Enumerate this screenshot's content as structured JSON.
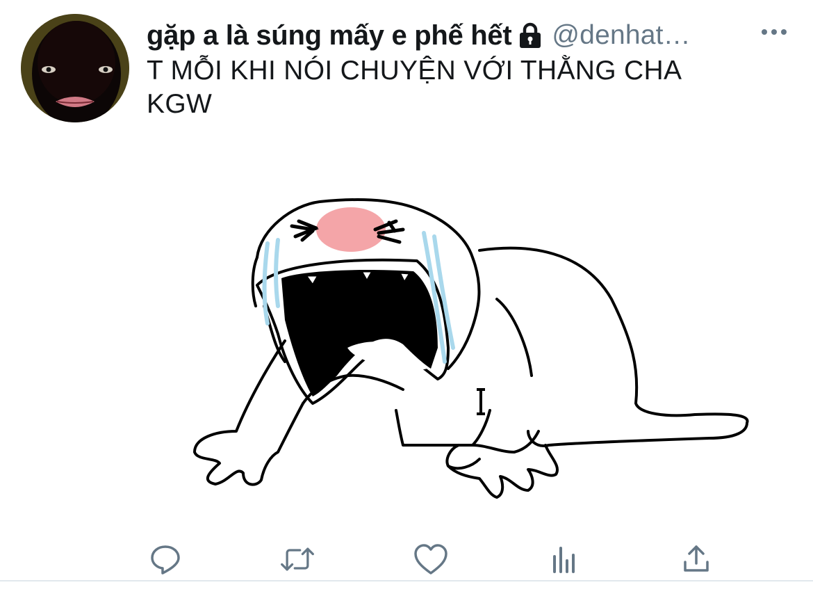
{
  "tweet": {
    "display_name": "gặp a là súng mấy e phế hết",
    "handle": "@denhat…",
    "text_line1": "T MỖI KHI NÓI CHUYỆN VỚI THẰNG CHA",
    "text_line2": "KGW",
    "protected_icon": "lock-icon",
    "more_icon": "more-dots-icon"
  },
  "actions": {
    "reply_icon": "reply-icon",
    "retweet_icon": "retweet-icon",
    "like_icon": "heart-icon",
    "analytics_icon": "analytics-icon",
    "share_icon": "share-icon"
  },
  "colors": {
    "text": "#14171a",
    "secondary": "#657786",
    "divider": "#e1e8ed",
    "icon": "#657786",
    "blush": "#f4a5a8",
    "tears": "#a9d8ec"
  }
}
